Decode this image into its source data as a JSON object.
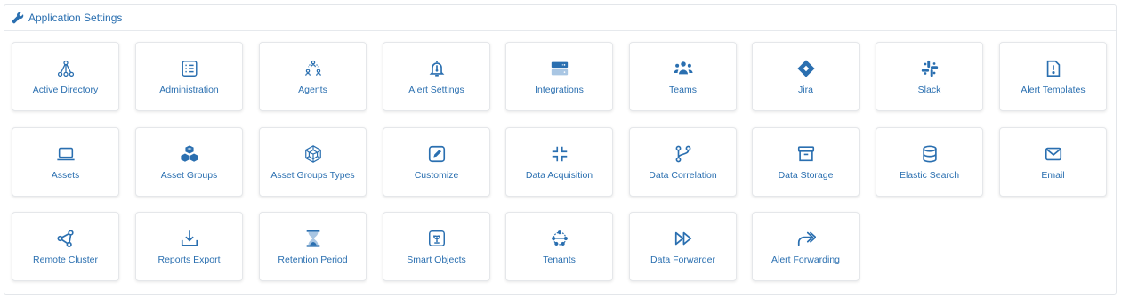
{
  "header": {
    "title": "Application Settings",
    "icon": "wrench-icon"
  },
  "colors": {
    "accent": "#2a6fb0",
    "border": "#e5e7ea"
  },
  "tiles": [
    {
      "label": "Active Directory",
      "icon": "hierarchy-icon"
    },
    {
      "label": "Administration",
      "icon": "list-icon"
    },
    {
      "label": "Agents",
      "icon": "users-network-icon"
    },
    {
      "label": "Alert Settings",
      "icon": "bell-icon"
    },
    {
      "label": "Integrations",
      "icon": "server-icon"
    },
    {
      "label": "Teams",
      "icon": "team-icon"
    },
    {
      "label": "Jira",
      "icon": "jira-icon"
    },
    {
      "label": "Slack",
      "icon": "slack-icon"
    },
    {
      "label": "Alert Templates",
      "icon": "file-alert-icon"
    },
    {
      "label": "Assets",
      "icon": "laptop-icon"
    },
    {
      "label": "Asset Groups",
      "icon": "cubes-icon"
    },
    {
      "label": "Asset Groups Types",
      "icon": "polyhedron-icon"
    },
    {
      "label": "Customize",
      "icon": "edit-icon"
    },
    {
      "label": "Data Acquisition",
      "icon": "compress-icon"
    },
    {
      "label": "Data Correlation",
      "icon": "branch-icon"
    },
    {
      "label": "Data Storage",
      "icon": "archive-icon"
    },
    {
      "label": "Elastic Search",
      "icon": "database-icon"
    },
    {
      "label": "Email",
      "icon": "envelope-icon"
    },
    {
      "label": "Remote Cluster",
      "icon": "share-nodes-icon"
    },
    {
      "label": "Reports Export",
      "icon": "download-icon"
    },
    {
      "label": "Retention Period",
      "icon": "hourglass-icon"
    },
    {
      "label": "Smart Objects",
      "icon": "smart-object-icon"
    },
    {
      "label": "Tenants",
      "icon": "network-icon"
    },
    {
      "label": "Data Forwarder",
      "icon": "fast-forward-icon"
    },
    {
      "label": "Alert Forwarding",
      "icon": "forward-arrow-icon"
    }
  ]
}
